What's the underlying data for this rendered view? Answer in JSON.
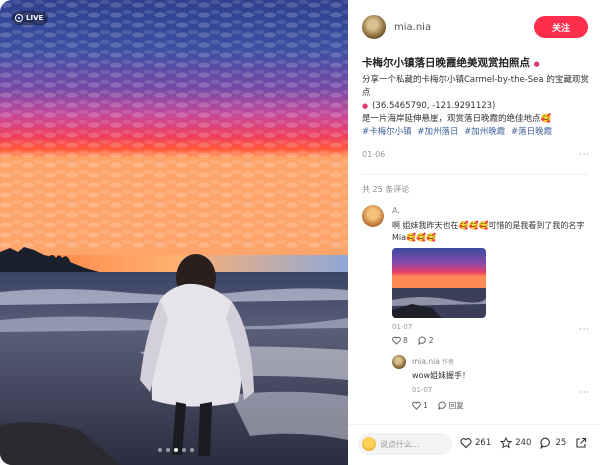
{
  "photo": {
    "live_label": "LIVE",
    "carousel_count": 5,
    "carousel_active": 3
  },
  "author": {
    "name": "mia.nia",
    "follow_label": "关注"
  },
  "post": {
    "title": "卡梅尔小镇落日晚霞绝美观赏拍照点",
    "description_line1": "分享一个私藏的卡梅尔小镇Carmel-by-the-Sea 的宝藏观赏点",
    "coordinates": "(36.5465790, -121.9291123)",
    "description_line2": "是一片海岸延伸悬崖，观赏落日晚霞的绝佳地点🥰",
    "tags": [
      "#卡梅尔小镇",
      "#加州落日",
      "#加州晚霞",
      "#落日晚霞"
    ],
    "date": "01-06"
  },
  "comments": {
    "count_label": "共 25 条评论",
    "items": [
      {
        "name": "A.",
        "text": "啊 姐妹我昨天也在🥰🥰🥰可惜的是我看到了我的名字Mia🥰🥰🥰",
        "date": "01-07",
        "likes": "8",
        "replies": "2"
      }
    ],
    "reply": {
      "name": "mia.nia",
      "badge": "作者",
      "text": "wow姐妹握手！",
      "date": "01-07",
      "likes": "1",
      "reply_label": "回复"
    }
  },
  "bottom_bar": {
    "input_placeholder": "说点什么...",
    "likes": "261",
    "favorites": "240",
    "comments": "25"
  },
  "colors": {
    "accent": "#ff2e4d",
    "tag": "#3d5f99"
  }
}
